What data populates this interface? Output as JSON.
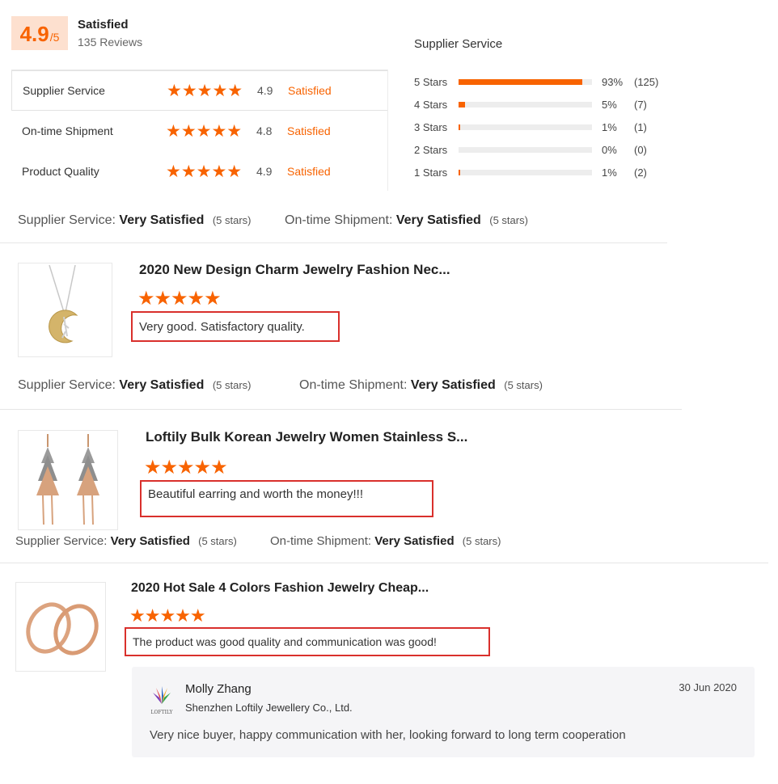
{
  "summary": {
    "score": "4.9",
    "score_max": "/5",
    "title": "Satisfied",
    "review_count": "135 Reviews"
  },
  "ratings": [
    {
      "label": "Supplier Service",
      "stars": "★★★★★",
      "value": "4.9",
      "status": "Satisfied"
    },
    {
      "label": "On-time Shipment",
      "stars": "★★★★★",
      "value": "4.8",
      "status": "Satisfied"
    },
    {
      "label": "Product Quality",
      "stars": "★★★★★",
      "value": "4.9",
      "status": "Satisfied"
    }
  ],
  "breakdown": {
    "title": "Supplier Service",
    "rows": [
      {
        "label": "5 Stars",
        "fraction": 0.93,
        "pct": "93%",
        "count": "(125)"
      },
      {
        "label": "4 Stars",
        "fraction": 0.05,
        "pct": "5%",
        "count": "(7)"
      },
      {
        "label": "3 Stars",
        "fraction": 0.01,
        "pct": "1%",
        "count": "(1)"
      },
      {
        "label": "2 Stars",
        "fraction": 0.0,
        "pct": "0%",
        "count": "(0)"
      },
      {
        "label": "1 Stars",
        "fraction": 0.01,
        "pct": "1%",
        "count": "(2)"
      }
    ]
  },
  "overall_line": {
    "service_label": "Supplier Service:",
    "service_value": "Very Satisfied",
    "service_stars": "(5 stars)",
    "shipment_label": "On-time Shipment:",
    "shipment_value": "Very Satisfied",
    "shipment_stars": "(5 stars)"
  },
  "reviews": [
    {
      "title": "2020 New Design Charm Jewelry Fashion Nec...",
      "stars": "★★★★★",
      "text": "Very good. Satisfactory quality.",
      "service_label": "Supplier Service:",
      "service_value": "Very Satisfied",
      "service_stars": "(5 stars)",
      "shipment_label": "On-time Shipment:",
      "shipment_value": "Very Satisfied",
      "shipment_stars": "(5 stars)"
    },
    {
      "title": "Loftily Bulk Korean Jewelry Women Stainless S...",
      "stars": "★★★★★",
      "text": "Beautiful earring and worth the money!!!",
      "service_label": "Supplier Service:",
      "service_value": "Very Satisfied",
      "service_stars": "(5 stars)",
      "shipment_label": "On-time Shipment:",
      "shipment_value": "Very Satisfied",
      "shipment_stars": "(5 stars)"
    },
    {
      "title": "2020 Hot Sale 4 Colors Fashion Jewelry Cheap...",
      "stars": "★★★★★",
      "text": "The product was good quality and communication was good!"
    }
  ],
  "reply": {
    "name": "Molly Zhang",
    "company": "Shenzhen Loftily Jewellery Co., Ltd.",
    "date": "30 Jun 2020",
    "text": "Very nice buyer, happy communication with her, looking forward to long term cooperation",
    "logo_text": "LOFTILY"
  },
  "colors": {
    "accent": "#f86300",
    "highlight": "#d9302c",
    "badge_bg": "#fde0cf"
  }
}
